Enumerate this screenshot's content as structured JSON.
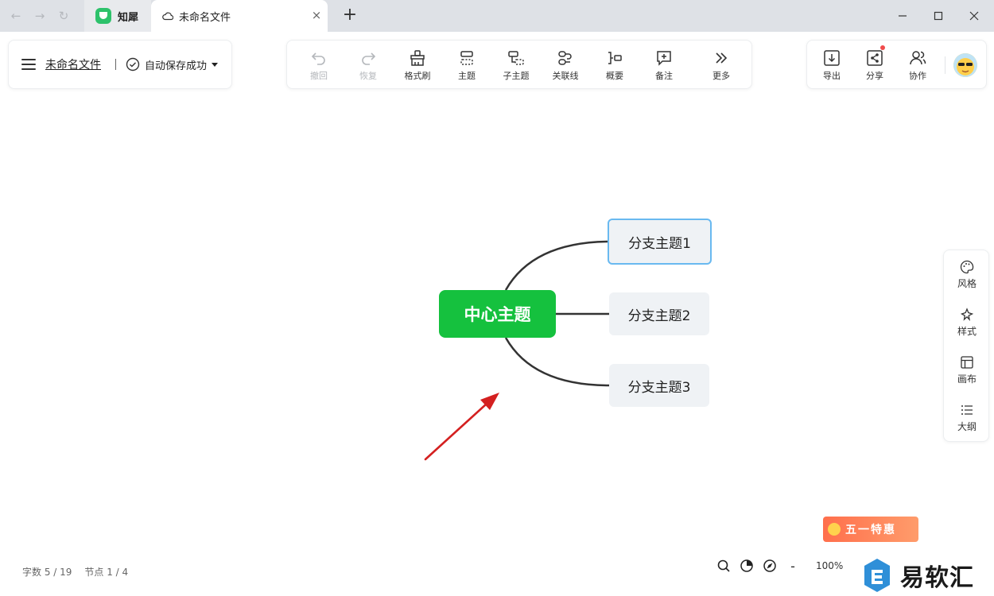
{
  "browser": {
    "app_tab_label": "知犀",
    "file_tab_label": "未命名文件",
    "new_tab_glyph": "+",
    "close_glyph": "×"
  },
  "header": {
    "file_name": "未命名文件",
    "save_status": "自动保存成功"
  },
  "toolbar": {
    "items": [
      {
        "label": "撤回",
        "icon": "undo-icon"
      },
      {
        "label": "恢复",
        "icon": "redo-icon"
      },
      {
        "label": "格式刷",
        "icon": "format-brush-icon"
      },
      {
        "label": "主题",
        "icon": "topic-icon"
      },
      {
        "label": "子主题",
        "icon": "subtopic-icon"
      },
      {
        "label": "关联线",
        "icon": "relation-line-icon"
      },
      {
        "label": "概要",
        "icon": "summary-icon"
      },
      {
        "label": "备注",
        "icon": "note-icon"
      },
      {
        "label": "更多",
        "icon": "more-icon"
      }
    ]
  },
  "actions": {
    "export_label": "导出",
    "share_label": "分享",
    "collab_label": "协作"
  },
  "side_panel": {
    "style_label": "风格",
    "format_label": "样式",
    "canvas_label": "画布",
    "outline_label": "大纲"
  },
  "mindmap": {
    "center": "中心主题",
    "branches": [
      "分支主题1",
      "分支主题2",
      "分支主题3"
    ]
  },
  "footer": {
    "word_count": "字数 5 / 19",
    "node_count": "节点 1 / 4",
    "zoom": "100%",
    "zoom_out_glyph": "-"
  },
  "promo": {
    "text": "五一特惠"
  },
  "watermark": {
    "text": "易软汇"
  },
  "colors": {
    "center_node": "#15c13e",
    "branch_node": "#eff2f5",
    "selected_border": "#69b9f0",
    "annotation_arrow": "#d42020"
  }
}
